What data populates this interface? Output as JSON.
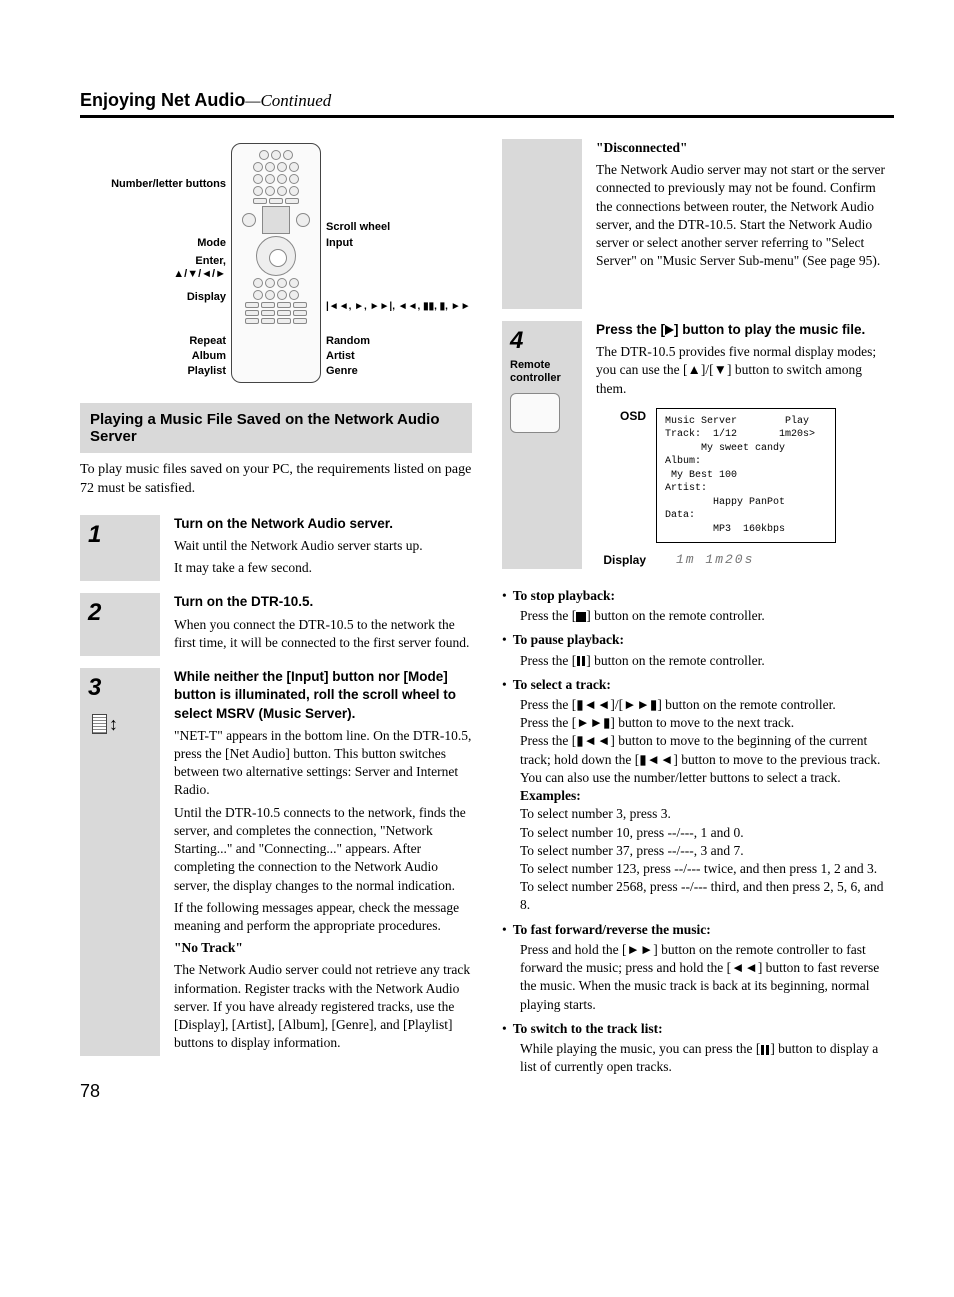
{
  "header": {
    "title": "Enjoying Net Audio",
    "continued": "—Continued"
  },
  "remote_labels": {
    "number_letter": "Number/letter buttons",
    "mode": "Mode",
    "enter": "Enter,",
    "arrows": "▲/▼/◄/►",
    "display": "Display",
    "repeat": "Repeat",
    "album": "Album",
    "playlist": "Playlist",
    "scroll_wheel": "Scroll wheel",
    "input": "Input",
    "transport": "|◄◄, ►, ►►|, ◄◄, ▮▮, ▮, ►►",
    "random": "Random",
    "artist": "Artist",
    "genre": "Genre"
  },
  "section_title": "Playing a Music File Saved on the Network Audio Server",
  "intro": "To play music files saved on your PC, the requirements listed on page 72 must be satisfied.",
  "steps": {
    "s1": {
      "num": "1",
      "head": "Turn on the Network Audio server.",
      "body1": "Wait until the Network Audio server starts up.",
      "body2": "It may take a few second."
    },
    "s2": {
      "num": "2",
      "head": "Turn on the DTR-10.5.",
      "body1": "When you connect the DTR-10.5 to the network the first time, it will be connected to the first server found."
    },
    "s3": {
      "num": "3",
      "head": "While neither the [Input] button nor [Mode] button is illuminated, roll the scroll wheel to select MSRV (Music Server).",
      "p1": "\"NET-T\" appears in the bottom line. On the DTR-10.5, press the [Net Audio] button. This button switches between two alternative settings: Server and Internet Radio.",
      "p2": "Until the DTR-10.5 connects to the network, finds the server, and completes the connection, \"Network Starting...\" and \"Connecting...\" appears. After completing the connection to the Network Audio server, the display changes to the normal indication.",
      "p3": "If the following messages appear, check the message meaning and perform the appropriate procedures.",
      "no_track_h": "\"No Track\"",
      "no_track_b": "The Network Audio server could not retrieve any track information. Register tracks with the Network Audio server. If you have already registered tracks, use the [Display], [Artist], [Album], [Genre], and [Playlist] buttons to display information."
    },
    "disc": {
      "h": "\"Disconnected\"",
      "b": "The Network Audio server may not start or the server connected to previously may not be found. Confirm the connections between router, the Network Audio server, and the DTR-10.5. Start the Network Audio server or select another server referring to \"Select Server\" on \"Music Server Sub-menu\" (See page 95)."
    },
    "s4": {
      "num": "4",
      "sub": "Remote controller",
      "head_a": "Press the [",
      "head_b": "] button to play the music file.",
      "body_a": "The DTR-10.5 provides five normal display modes; you can use the [",
      "body_b": "]/[",
      "body_c": "] button to switch among them.",
      "osd_label": "OSD",
      "display_label": "Display"
    }
  },
  "osd": {
    "l1": "Music Server        Play",
    "l2": "Track:  1/12       1m20s>",
    "l3": "      My sweet candy",
    "l4": "Album:",
    "l5": " My Best 100",
    "l6": "Artist:",
    "l7": "        Happy PanPot",
    "l8": "Data:",
    "l9": "        MP3  160kbps"
  },
  "display_value": "1m    1m20s",
  "controls": {
    "stop_h": "To stop playback:",
    "stop_b_a": "Press the [",
    "stop_b_b": "] button on the remote controller.",
    "pause_h": "To pause playback:",
    "pause_b_a": "Press the [",
    "pause_b_b": "] button on the remote controller.",
    "select_h": "To select a track:",
    "select_b1_a": "Press the [",
    "select_b1_b": "]/[",
    "select_b1_c": "] button on the remote controller.",
    "select_b2_a": "Press the [",
    "select_b2_b": "] button to move to the next track.",
    "select_b3_a": "Press the [",
    "select_b3_b": "] button to move to the beginning of the current track; hold down the [",
    "select_b3_c": "] button to move to the previous track.",
    "select_b4": "You can also use the number/letter buttons to select a track.",
    "ex_h": "Examples:",
    "ex1": "To select number 3, press 3.",
    "ex2": "To select number 10, press --/---, 1 and 0.",
    "ex3": "To select number 37, press --/---, 3 and 7.",
    "ex4": "To select number 123, press --/--- twice, and then press 1, 2 and 3.",
    "ex5": "To select number 2568, press --/--- third, and then press 2, 5, 6, and 8.",
    "ff_h": "To fast forward/reverse the music:",
    "ff_b_a": "Press and hold the [",
    "ff_b_b": "] button on the remote controller to fast forward the music; press and hold the [",
    "ff_b_c": "] button to fast reverse the music. When the music track is back at its beginning, normal playing starts.",
    "list_h": "To switch to the track list:",
    "list_b_a": "While playing the music, you can press the [",
    "list_b_b": "] button to display a list of currently open tracks."
  },
  "page_number": "78"
}
